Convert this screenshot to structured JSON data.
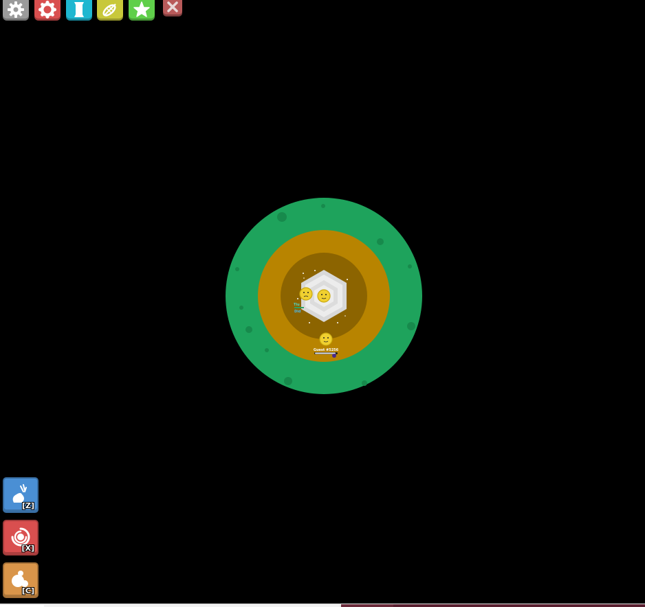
{
  "top_menu": {
    "buttons": [
      {
        "name": "settings",
        "icon": "gear-icon",
        "color": "#9b9b9b"
      },
      {
        "name": "changelog",
        "icon": "petal-ring-icon",
        "color": "#d94f4f"
      },
      {
        "name": "inventory",
        "icon": "scroll-icon",
        "color": "#1fb7d0"
      },
      {
        "name": "crafting",
        "icon": "leaf-icon",
        "color": "#c8c83a"
      },
      {
        "name": "mobs",
        "icon": "star-icon",
        "color": "#5fcf4a"
      }
    ],
    "close_icon": "close-icon",
    "close_color": "#b85a5a"
  },
  "side_buttons": [
    {
      "name": "loadout-swap",
      "icon": "drop-bag-icon",
      "key": "[Z]",
      "color": "#4a8fd4"
    },
    {
      "name": "rotate",
      "icon": "spiral-icon",
      "key": "[X]",
      "color": "#d94f4f"
    },
    {
      "name": "bubbles",
      "icon": "bubbles-icon",
      "key": "[C]",
      "color": "#d9954a"
    }
  ],
  "map": {
    "outer_zone_color": "#1ea35c",
    "middle_zone_color": "#b88400",
    "inner_zone_color": "#8c6400",
    "hive_color": "#e8e8e8"
  },
  "players": [
    {
      "name": "Guest #5256",
      "is_self": true
    },
    {
      "name": "Tiu",
      "is_self": false
    },
    {
      "name": "Did",
      "is_self": false
    }
  ]
}
